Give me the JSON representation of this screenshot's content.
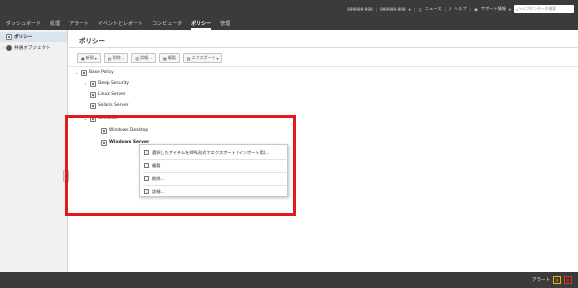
{
  "header": {
    "user1": "999999-999",
    "user2": "999999-999",
    "news": "ニュース",
    "help": "ヘルプ",
    "support": "サポート情報",
    "search_placeholder": "ヘルプセンターの検索"
  },
  "nav": {
    "items": [
      "ダッシュボード",
      "処理",
      "アラート",
      "イベントとレポート",
      "コンピュータ",
      "ポリシー",
      "管理"
    ],
    "active_index": 5
  },
  "sidebar": {
    "items": [
      {
        "label": "ポリシー",
        "icon": "policy-icon",
        "selected": true
      },
      {
        "label": "共通オブジェクト",
        "icon": "common-objects-icon",
        "selected": false
      }
    ]
  },
  "main": {
    "title": "ポリシー",
    "toolbar": [
      {
        "label": "新規",
        "icon": "new-icon"
      },
      {
        "label": "削除...",
        "icon": "delete-icon"
      },
      {
        "label": "詳細...",
        "icon": "details-icon"
      },
      {
        "label": "複製",
        "icon": "duplicate-icon"
      },
      {
        "label": "エクスポート",
        "icon": "export-icon"
      }
    ],
    "tree": [
      {
        "label": "Base Policy",
        "caret": "v"
      },
      {
        "label": "Deep Security",
        "caret": ">"
      },
      {
        "label": "Linux Server",
        "caret": ""
      },
      {
        "label": "Solaris Server",
        "caret": ""
      },
      {
        "label": "Windows",
        "caret": "v"
      },
      {
        "label": "Windows Desktop",
        "caret": ""
      },
      {
        "label": "Windows Server",
        "caret": ""
      }
    ]
  },
  "context_menu": {
    "items": [
      "選択したアイテムをXML形式でエクスポート (インポート用)...",
      "複製",
      "削除...",
      "詳細..."
    ]
  },
  "status": {
    "alert_label": "アラート",
    "warning_count": "0",
    "critical_count": "0"
  },
  "colors": {
    "highlight": "#e3191c",
    "dark_bar": "#3b3b3b"
  }
}
